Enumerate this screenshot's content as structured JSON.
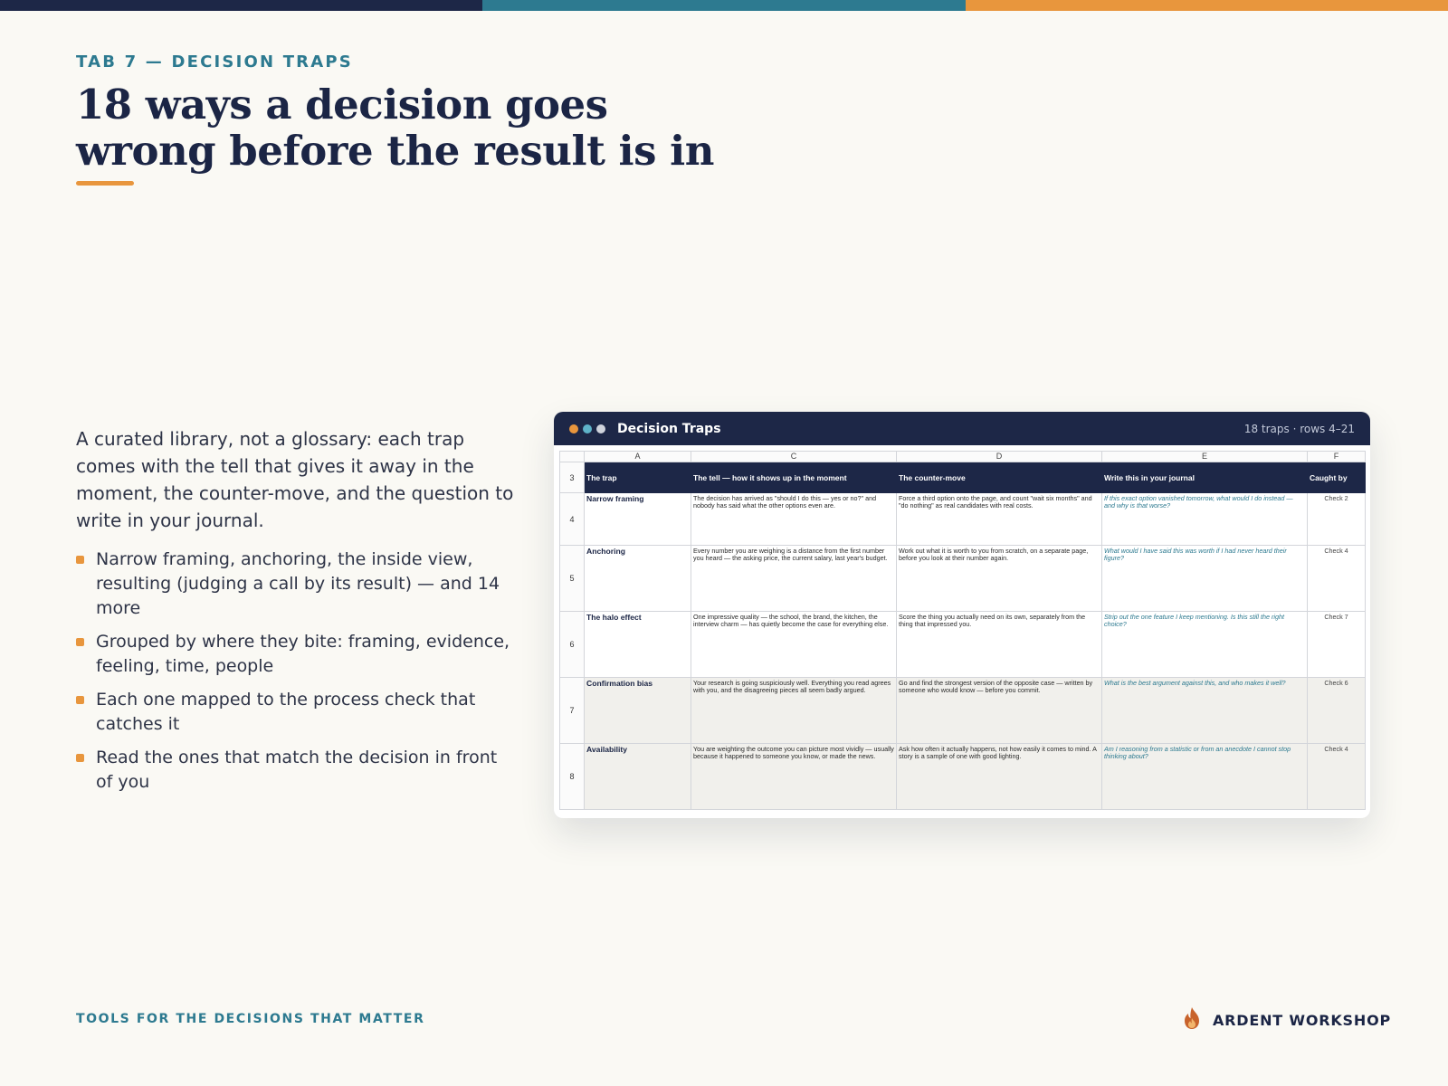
{
  "colors": {
    "navy": "#1d2747",
    "teal": "#2d7a90",
    "orange": "#e8963d",
    "background": "#faf9f4",
    "dot_orange": "#e8963d",
    "dot_teal": "#5fb3c9",
    "dot_grey": "#cfd3dc"
  },
  "header": {
    "eyebrow": "TAB 7 — DECISION TRAPS",
    "title_line1": "18 ways a decision goes",
    "title_line2": "wrong before the result is in"
  },
  "body": {
    "lead": "A curated library, not a glossary: each trap comes with the tell that gives it away in the moment, the counter-move, and the question to write in your journal.",
    "bullets": [
      "Narrow framing, anchoring, the inside view, resulting (judging a call by its result) — and 14 more",
      "Grouped by where they bite: framing, evidence, feeling, time, people",
      "Each one mapped to the process check that catches it",
      "Read the ones that match the decision in front of you"
    ]
  },
  "window": {
    "title": "Decision Traps",
    "meta": "18 traps · rows 4–21",
    "column_letters": [
      "",
      "A",
      "C",
      "D",
      "E",
      "F"
    ],
    "header_row": {
      "row_number": "3",
      "cells": [
        "The trap",
        "The tell — how it shows up in the moment",
        "The counter-move",
        "Write this in your journal",
        "Caught by"
      ]
    },
    "rows": [
      {
        "row_number": "4",
        "trap": "Narrow framing",
        "tell": "The decision has arrived as \"should I do this — yes or no?\" and nobody has said what the other options even are.",
        "counter": "Force a third option onto the page, and count \"wait six months\" and \"do nothing\" as real candidates with real costs.",
        "journal": "If this exact option vanished tomorrow, what would I do instead — and why is that worse?",
        "check": "Check 2"
      },
      {
        "row_number": "5",
        "trap": "Anchoring",
        "tell": "Every number you are weighing is a distance from the first number you heard — the asking price, the current salary, last year's budget.",
        "counter": "Work out what it is worth to you from scratch, on a separate page, before you look at their number again.",
        "journal": "What would I have said this was worth if I had never heard their figure?",
        "check": "Check 4"
      },
      {
        "row_number": "6",
        "trap": "The halo effect",
        "tell": "One impressive quality — the school, the brand, the kitchen, the interview charm — has quietly become the case for everything else.",
        "counter": "Score the thing you actually need on its own, separately from the thing that impressed you.",
        "journal": "Strip out the one feature I keep mentioning. Is this still the right choice?",
        "check": "Check 7"
      },
      {
        "row_number": "7",
        "trap": "Confirmation bias",
        "tell": "Your research is going suspiciously well. Everything you read agrees with you, and the disagreeing pieces all seem badly argued.",
        "counter": "Go and find the strongest version of the opposite case — written by someone who would know — before you commit.",
        "journal": "What is the best argument against this, and who makes it well?",
        "check": "Check 6"
      },
      {
        "row_number": "8",
        "trap": "Availability",
        "tell": "You are weighting the outcome you can picture most vividly — usually because it happened to someone you know, or made the news.",
        "counter": "Ask how often it actually happens, not how easily it comes to mind. A story is a sample of one with good lighting.",
        "journal": "Am I reasoning from a statistic or from an anecdote I cannot stop thinking about?",
        "check": "Check 4"
      }
    ]
  },
  "footer": {
    "tagline": "TOOLS FOR THE DECISIONS THAT MATTER",
    "brand": "ARDENT WORKSHOP",
    "brand_icon": "flame-icon"
  }
}
